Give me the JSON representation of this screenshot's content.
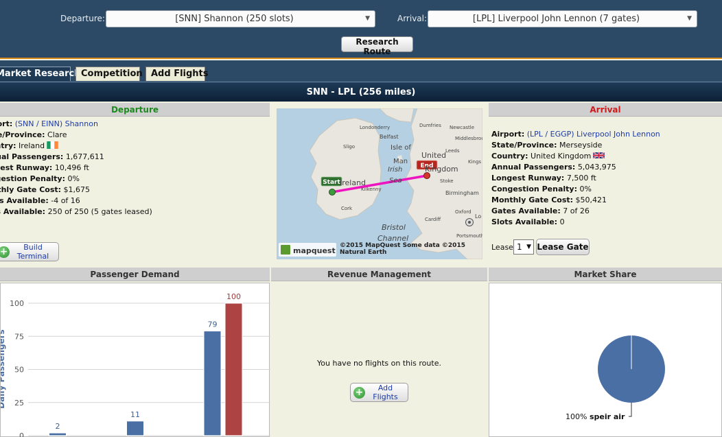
{
  "search": {
    "departure_label": "Departure:",
    "departure_value": "[SNN] Shannon (250 slots)",
    "arrival_label": "Arrival:",
    "arrival_value": "[LPL] Liverpool John Lennon (7 gates)",
    "research_button": "Research Route"
  },
  "tabs": [
    {
      "label": "Market Research",
      "active": true
    },
    {
      "label": "Competition",
      "active": false
    },
    {
      "label": "Add Flights",
      "active": false
    }
  ],
  "route_title": "SNN - LPL (256 miles)",
  "departure": {
    "heading": "Departure",
    "rows": [
      {
        "label": "Airport:",
        "value": "(SNN / EINN) Shannon",
        "link": true
      },
      {
        "label": "State/Province:",
        "value": "Clare"
      },
      {
        "label": "Country:",
        "value": "Ireland"
      },
      {
        "label": "Annual Passengers:",
        "value": "1,677,611"
      },
      {
        "label": "Longest Runway:",
        "value": "10,496 ft"
      },
      {
        "label": "Congestion Penalty:",
        "value": "0%"
      },
      {
        "label": "Monthly Gate Cost:",
        "value": "$1,675"
      },
      {
        "label": "Gates Available:",
        "value": "-4 of 16"
      },
      {
        "label": "Slots Available:",
        "value": "250 of 250 (5 gates leased)"
      }
    ],
    "build_button": "Build Terminal"
  },
  "arrival": {
    "heading": "Arrival",
    "rows": [
      {
        "label": "Airport:",
        "value": "(LPL / EGGP) Liverpool John Lennon",
        "link": true
      },
      {
        "label": "State/Province:",
        "value": "Merseyside"
      },
      {
        "label": "Country:",
        "value": "United Kingdom"
      },
      {
        "label": "Annual Passengers:",
        "value": "5,043,975"
      },
      {
        "label": "Longest Runway:",
        "value": "7,500 ft"
      },
      {
        "label": "Congestion Penalty:",
        "value": "0%"
      },
      {
        "label": "Monthly Gate Cost:",
        "value": "$50,421"
      },
      {
        "label": "Gates Available:",
        "value": "7 of 26"
      },
      {
        "label": "Slots Available:",
        "value": "0"
      }
    ],
    "lease_label": "Lease",
    "lease_value": "1",
    "lease_button": "Lease Gate"
  },
  "map": {
    "start_label": "Start",
    "end_label": "End",
    "places": [
      "Londonderry",
      "Dumfries",
      "Newcastle",
      "Belfast",
      "Isle of",
      "Man",
      "Middlesbrough",
      "Sligo",
      "Irish",
      "Sea",
      "United",
      "Kingdom",
      "Leeds",
      "Kings",
      "Ireland",
      "Kilkenny",
      "Stoke",
      "Birmingham",
      "Cork",
      "Oxford",
      "Lo",
      "Cardiff",
      "Bristol",
      "Channel",
      "Portsmouth"
    ],
    "logo": "mapquest",
    "credit": "©2015 MapQuest Some data ©2015 Natural Earth"
  },
  "panels": {
    "demand": "Passenger Demand",
    "revenue": "Revenue Management",
    "share": "Market Share"
  },
  "revenue": {
    "message": "You have no flights on this route.",
    "add_button": "Add Flights"
  },
  "colors": {
    "blue": "#4a6fa5",
    "red": "#ad4343"
  },
  "chart_data": [
    {
      "type": "bar",
      "ylabel": "Daily Passengers",
      "ylim": [
        0,
        100
      ],
      "yticks": [
        0,
        25,
        50,
        75,
        100
      ],
      "series": [
        {
          "values": [
            2,
            11,
            79
          ],
          "color": "#4a6fa5"
        },
        {
          "values": [
            null,
            null,
            100
          ],
          "color": "#ad4343"
        }
      ],
      "data_labels": [
        2,
        11,
        79,
        100
      ]
    },
    {
      "type": "pie",
      "slices": [
        {
          "label": "speir air",
          "value": 100,
          "display": "100%"
        }
      ]
    }
  ]
}
